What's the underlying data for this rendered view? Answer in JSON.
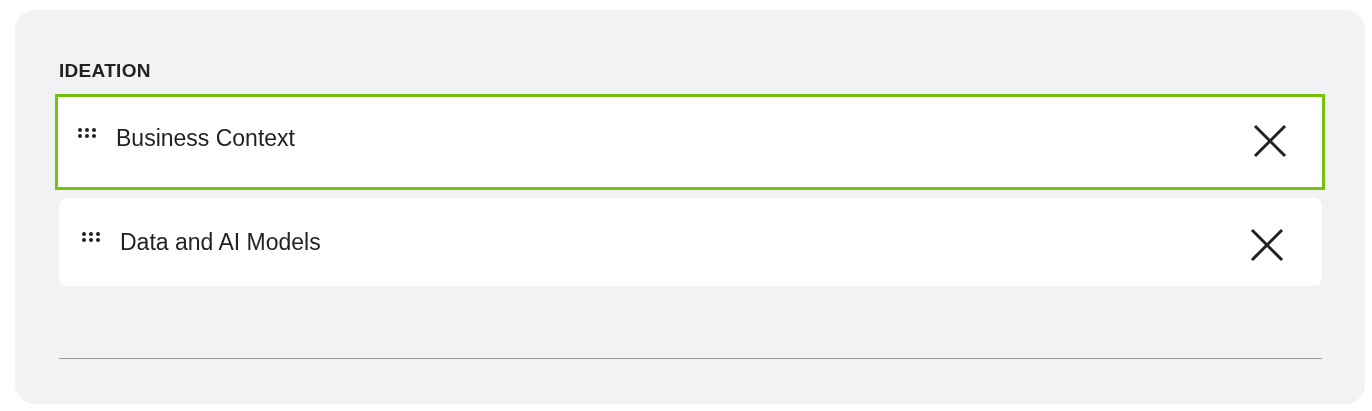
{
  "section": {
    "title": "IDEATION",
    "items": [
      {
        "label": "Business Context",
        "selected": true
      },
      {
        "label": "Data and AI Models",
        "selected": false
      }
    ]
  }
}
